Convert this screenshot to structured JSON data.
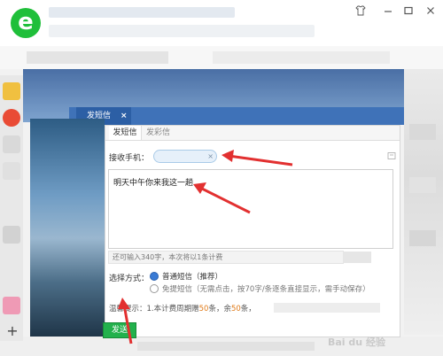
{
  "app": {
    "logo_letter": "e",
    "logo_color": "#1fbf3a",
    "window_controls": [
      "shirt-icon",
      "minimize-icon",
      "maximize-icon",
      "close-icon"
    ]
  },
  "dialog": {
    "tab_label": "发短信",
    "tab_close": "×",
    "subtabs": [
      "发短信",
      "发彩信"
    ],
    "recipient_label": "接收手机：",
    "recipient_clear": "×",
    "message": "明天中午你来我这一趟",
    "char_count": "还可输入340字，本次将以1条计费",
    "mode_label": "选择方式：",
    "options": [
      {
        "label": "普通短信（推荐）",
        "selected": true
      },
      {
        "label": "免提短信（无需点击，按70字/条逐条直接显示，需手动保存）",
        "selected": false
      }
    ],
    "hint_prefix": "温馨提示：1.本计费周期赠",
    "hint_num1": "50",
    "hint_mid": "条，余",
    "hint_num2": "50",
    "hint_suffix": "条，",
    "send_label": "发送",
    "accent_color": "#3f72b8",
    "send_color": "#22b14c"
  },
  "watermark": "Bai du 经验"
}
